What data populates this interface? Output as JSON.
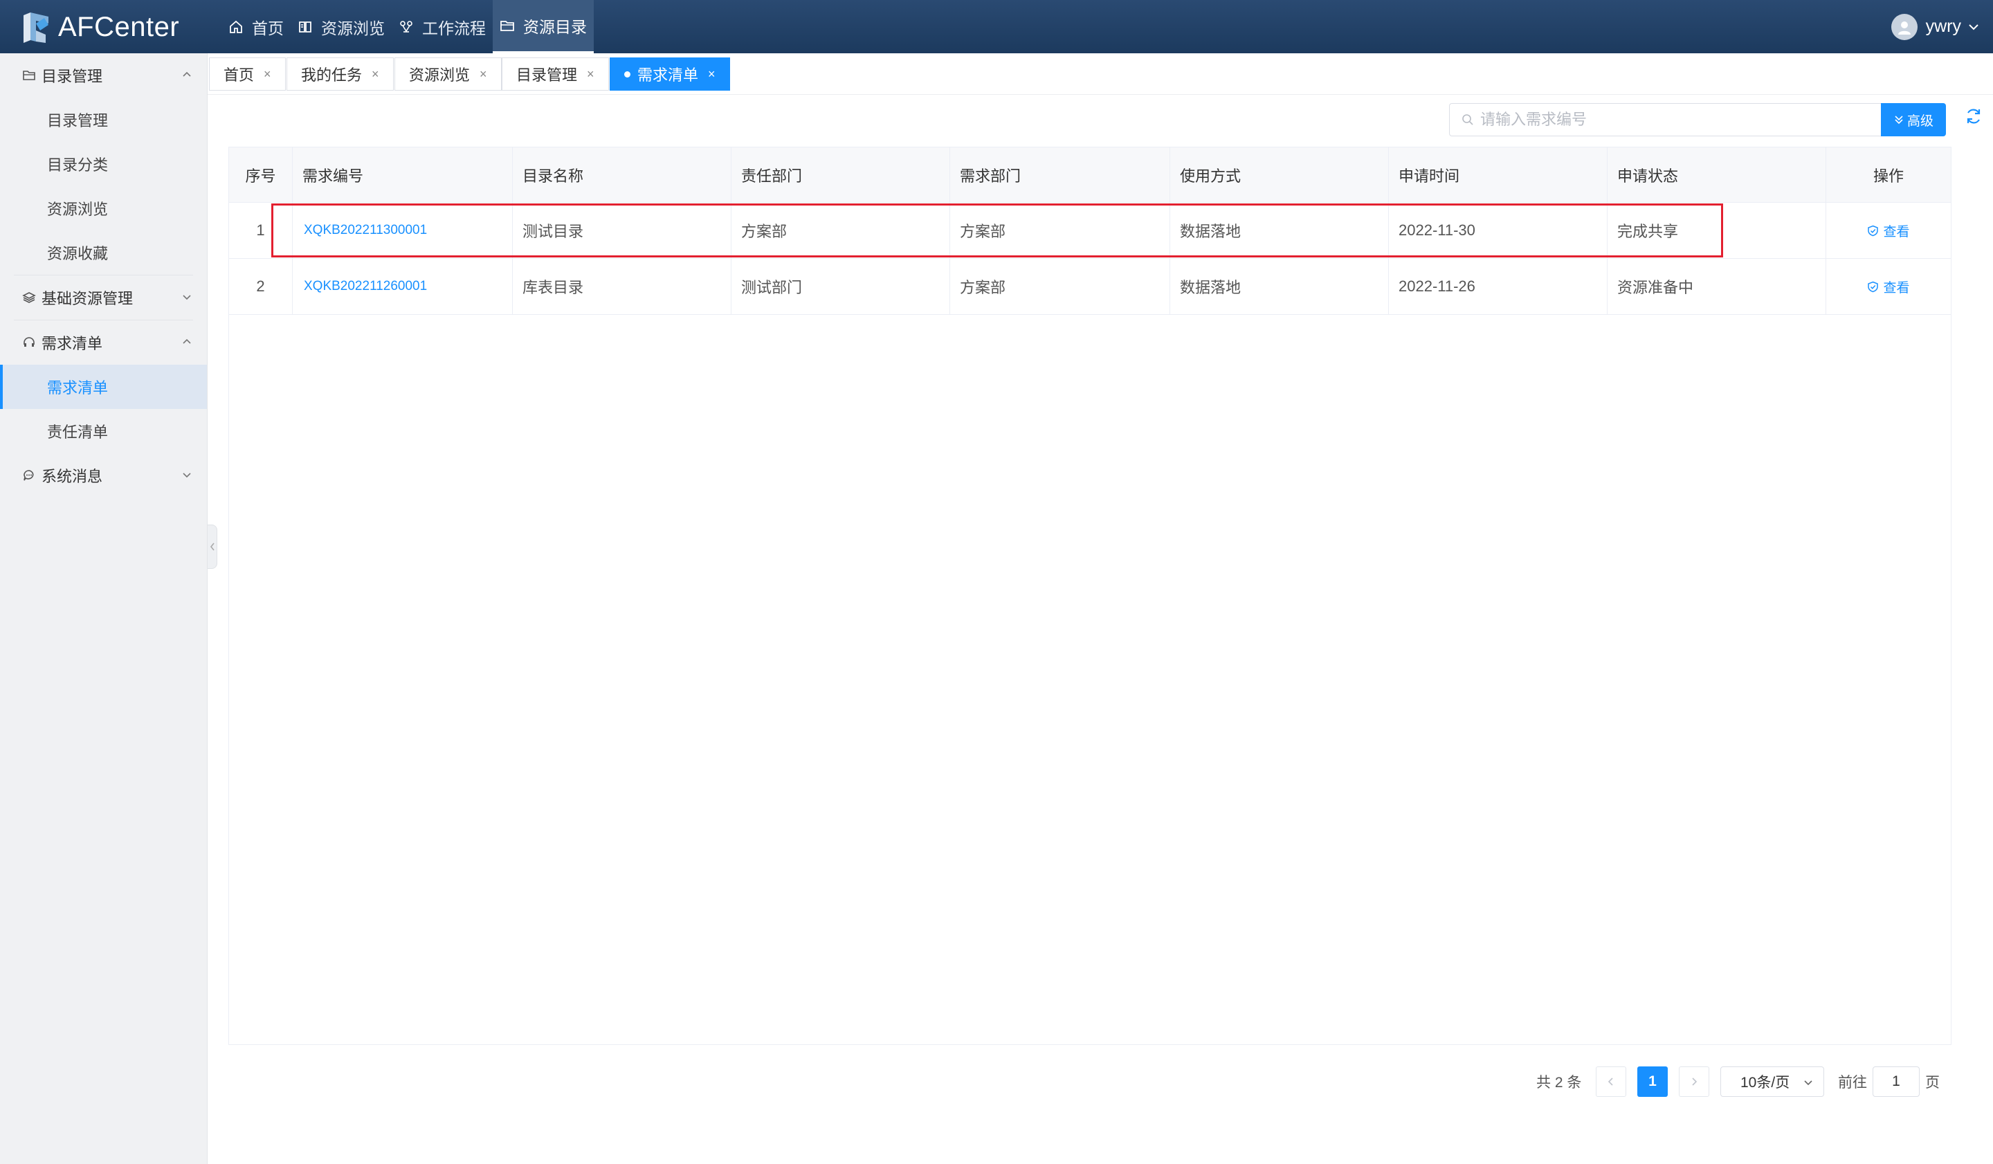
{
  "app": {
    "name": "AFCenter",
    "user": "ywry"
  },
  "topnav": [
    {
      "label": "首页",
      "icon": "home-icon"
    },
    {
      "label": "资源浏览",
      "icon": "book-icon"
    },
    {
      "label": "工作流程",
      "icon": "workflow-icon"
    },
    {
      "label": "资源目录",
      "icon": "folder-icon",
      "active": true
    }
  ],
  "sidebar": {
    "groups": [
      {
        "label": "目录管理",
        "icon": "folder-icon",
        "expanded": true,
        "items": [
          "目录管理",
          "目录分类",
          "资源浏览",
          "资源收藏"
        ]
      },
      {
        "label": "基础资源管理",
        "icon": "layers-icon",
        "expanded": false,
        "items": []
      },
      {
        "label": "需求清单",
        "icon": "headset-icon",
        "expanded": true,
        "items": [
          "需求清单",
          "责任清单"
        ],
        "active_item": "需求清单"
      },
      {
        "label": "系统消息",
        "icon": "chat-icon",
        "expanded": false,
        "items": []
      }
    ]
  },
  "tabs": [
    {
      "label": "首页"
    },
    {
      "label": "我的任务"
    },
    {
      "label": "资源浏览"
    },
    {
      "label": "目录管理"
    },
    {
      "label": "需求清单",
      "active": true
    }
  ],
  "search": {
    "placeholder": "请输入需求编号",
    "advanced_label": "高级"
  },
  "table": {
    "columns": [
      "序号",
      "需求编号",
      "目录名称",
      "责任部门",
      "需求部门",
      "使用方式",
      "申请时间",
      "申请状态",
      "操作"
    ],
    "rows": [
      {
        "index": "1",
        "req_no": "XQKB202211300001",
        "catalog": "测试目录",
        "resp_dept": "方案部",
        "req_dept": "方案部",
        "usage": "数据落地",
        "date": "2022-11-30",
        "status": "完成共享",
        "action": "查看"
      },
      {
        "index": "2",
        "req_no": "XQKB202211260001",
        "catalog": "库表目录",
        "resp_dept": "测试部门",
        "req_dept": "方案部",
        "usage": "数据落地",
        "date": "2022-11-26",
        "status": "资源准备中",
        "action": "查看"
      }
    ]
  },
  "pagination": {
    "total_text": "共 2 条",
    "current_page": "1",
    "page_size": "10条/页",
    "goto_prefix": "前往",
    "goto_value": "1",
    "goto_suffix": "页"
  },
  "colors": {
    "header": "#1c3a5e",
    "accent": "#1890ff",
    "highlight": "#e32030"
  }
}
